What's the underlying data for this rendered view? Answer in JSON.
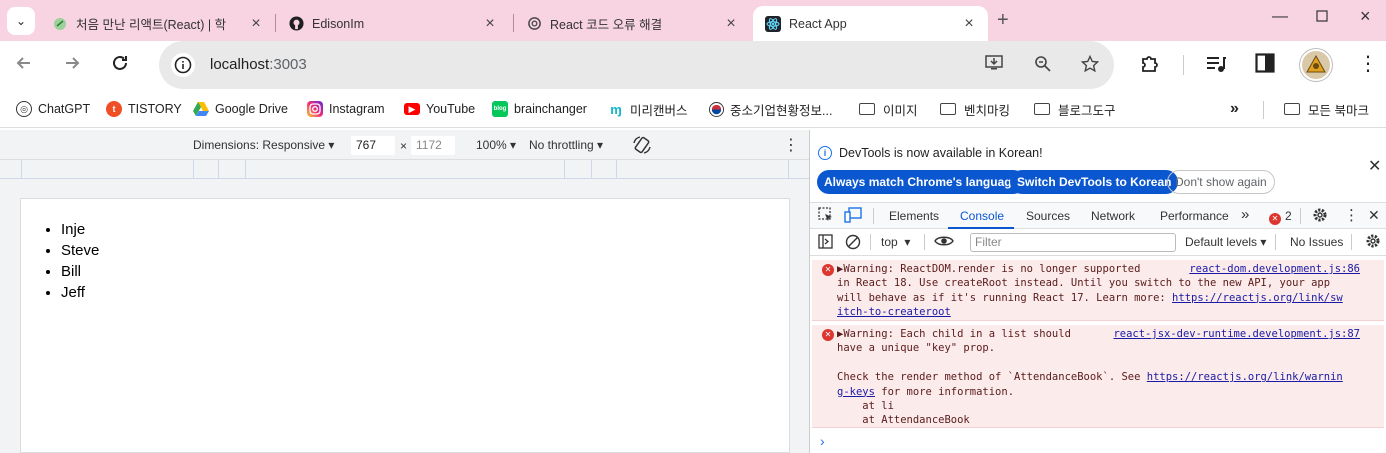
{
  "tabs": [
    {
      "title": "처음 만난 리액트(React) | 학",
      "icon": "leaf-icon"
    },
    {
      "title": "EdisonIm",
      "icon": "github-icon"
    },
    {
      "title": "React 코드 오류 해결",
      "icon": "openai-icon"
    },
    {
      "title": "React App",
      "icon": "react-icon",
      "active": true
    }
  ],
  "address": {
    "host": "localhost",
    "port": ":3003"
  },
  "bookmarks": [
    {
      "label": "ChatGPT",
      "icon": "chatgpt-icon"
    },
    {
      "label": "TISTORY",
      "icon": "tistory-icon"
    },
    {
      "label": "Google Drive",
      "icon": "google-drive-icon"
    },
    {
      "label": "Instagram",
      "icon": "instagram-icon"
    },
    {
      "label": "YouTube",
      "icon": "youtube-icon"
    },
    {
      "label": "brainchanger",
      "icon": "brainchanger-icon"
    },
    {
      "label": "미리캔버스",
      "icon": "miricanvas-icon"
    },
    {
      "label": "중소기업현황정보...",
      "icon": "korea-flag-icon"
    },
    {
      "label": "이미지",
      "icon": "folder-icon"
    },
    {
      "label": "벤치마킹",
      "icon": "folder-icon"
    },
    {
      "label": "블로그도구",
      "icon": "folder-icon"
    }
  ],
  "all_bookmarks": "모든 북마크",
  "device_toolbar": {
    "dimensions": "Dimensions: Responsive",
    "width": "767",
    "height": "1172",
    "times": "×",
    "zoom": "100%",
    "throttling": "No throttling"
  },
  "page_list": [
    "Inje",
    "Steve",
    "Bill",
    "Jeff"
  ],
  "devtools": {
    "info": "DevTools is now available in Korean!",
    "btn_match": "Always match Chrome's language",
    "btn_switch": "Switch DevTools to Korean",
    "btn_dismiss": "Don't show again",
    "tabs": [
      "Elements",
      "Console",
      "Sources",
      "Network",
      "Performance"
    ],
    "active_tab": "Console",
    "error_count": "2",
    "context": "top",
    "filter_placeholder": "Filter",
    "levels": "Default levels",
    "issues": "No Issues",
    "messages": [
      {
        "source": "react-dom.development.js:86",
        "lines": [
          "▶Warning: ReactDOM.render is no longer supported",
          "in React 18. Use createRoot instead. Until you switch to the new API, your app",
          "will behave as if it's running React 17. Learn more: "
        ],
        "link1": "https://reactjs.org/link/sw",
        "link2": "itch-to-createroot"
      },
      {
        "source": "react-jsx-dev-runtime.development.js:87",
        "lines": [
          "▶Warning: Each child in a list should",
          "have a unique \"key\" prop.",
          "",
          "Check the render method of `AttendanceBook`. See "
        ],
        "link1": "https://reactjs.org/link/warnin",
        "link2": "g-keys",
        "after_link": " for more information.",
        "stack": [
          "    at li",
          "    at AttendanceBook"
        ]
      }
    ]
  }
}
